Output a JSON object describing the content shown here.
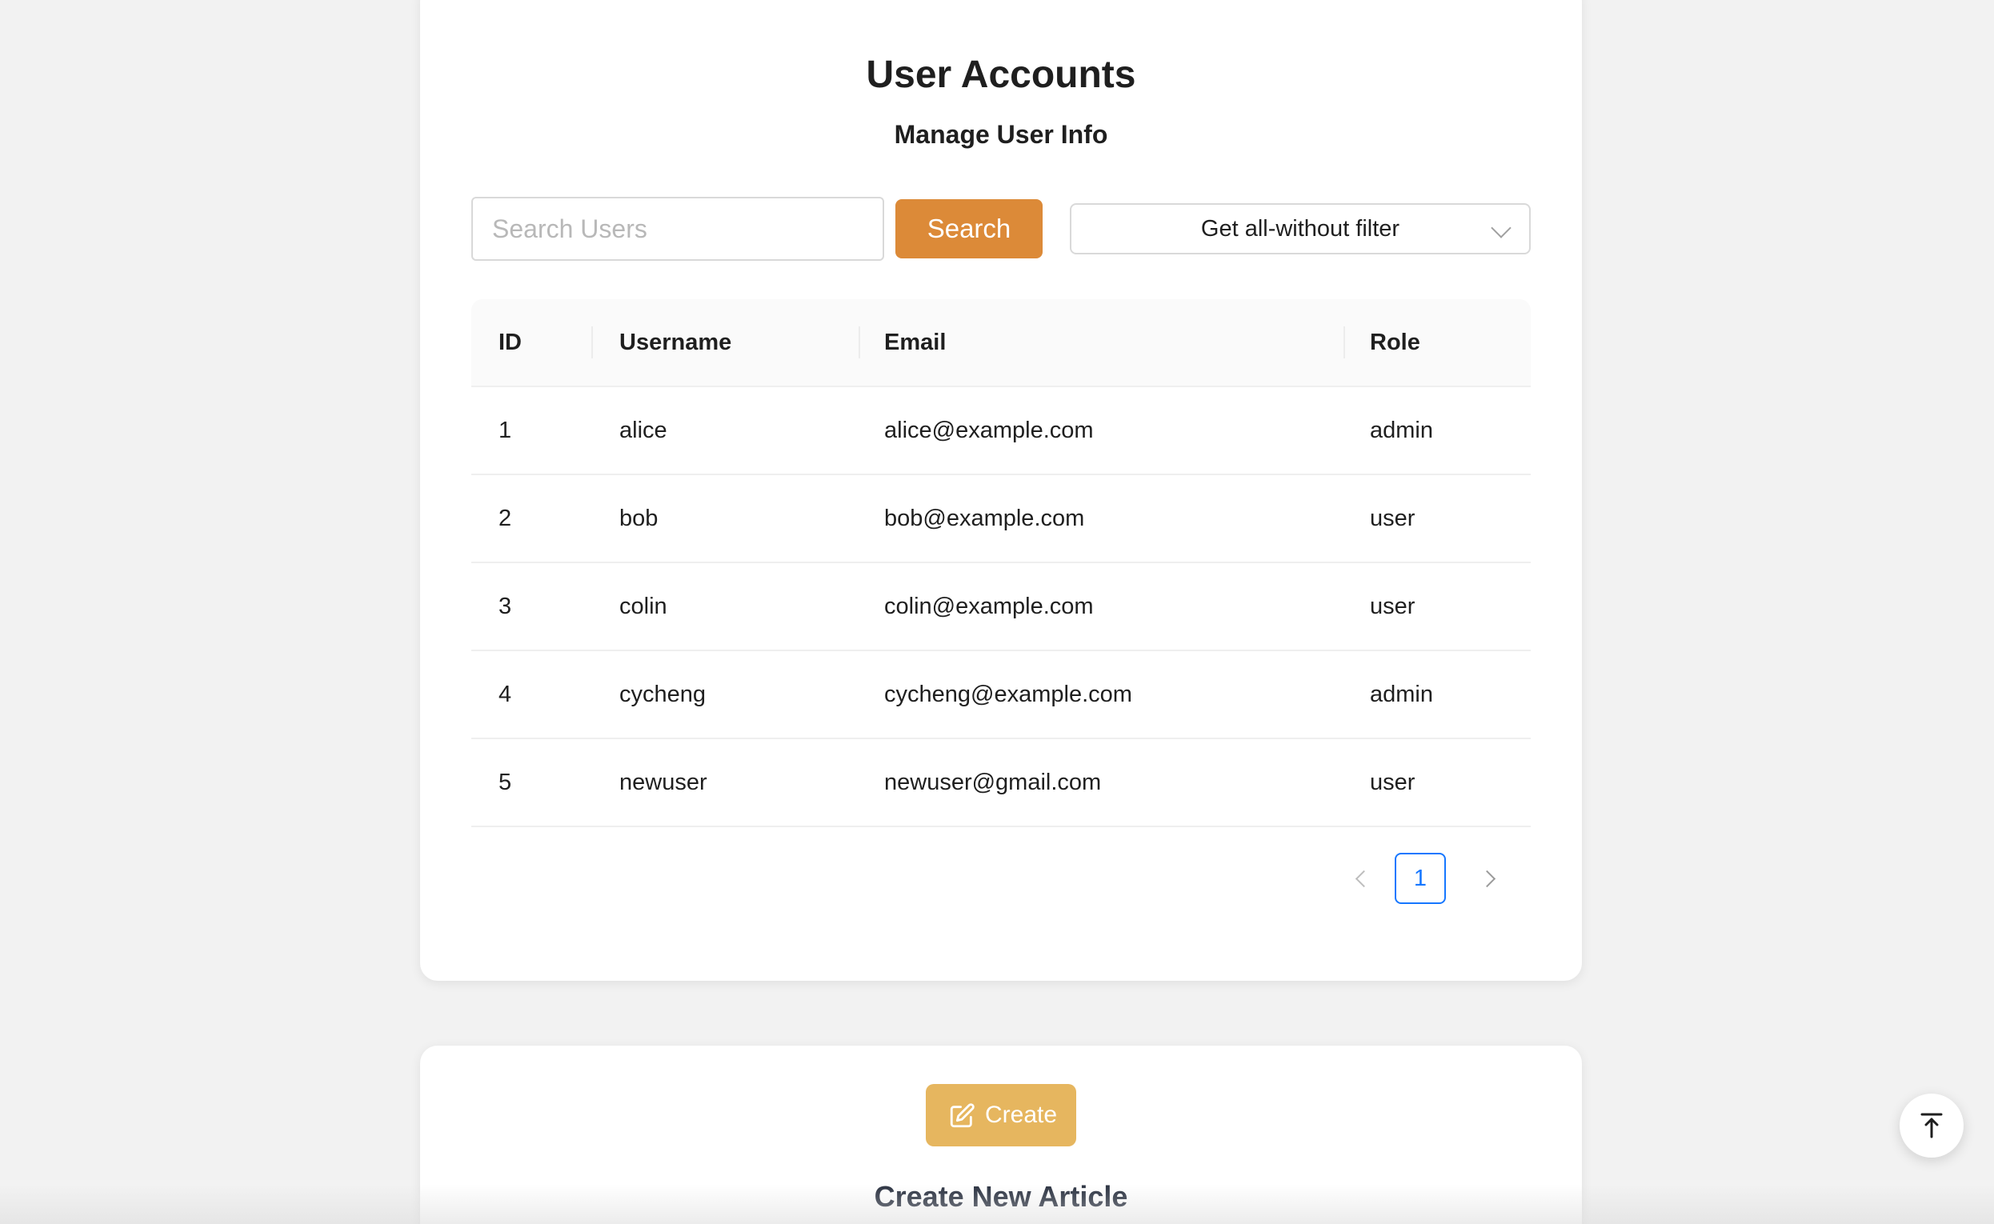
{
  "users_card": {
    "title": "User Accounts",
    "subtitle": "Manage User Info"
  },
  "search": {
    "placeholder": "Search Users",
    "value": "",
    "button_label": "Search"
  },
  "filter": {
    "selected": "Get all-without filter"
  },
  "table": {
    "columns": [
      "ID",
      "Username",
      "Email",
      "Role"
    ],
    "rows": [
      {
        "id": "1",
        "username": "alice",
        "email": "alice@example.com",
        "role": "admin"
      },
      {
        "id": "2",
        "username": "bob",
        "email": "bob@example.com",
        "role": "user"
      },
      {
        "id": "3",
        "username": "colin",
        "email": "colin@example.com",
        "role": "user"
      },
      {
        "id": "4",
        "username": "cycheng",
        "email": "cycheng@example.com",
        "role": "admin"
      },
      {
        "id": "5",
        "username": "newuser",
        "email": "newuser@gmail.com",
        "role": "user"
      }
    ]
  },
  "pagination": {
    "current_page": "1"
  },
  "create_card": {
    "button_label": "Create",
    "button_icon": "edit-icon",
    "title": "Create New Article"
  },
  "back_to_top": {
    "icon": "back-to-top-icon"
  },
  "colors": {
    "page_background": "#f2f2f2",
    "search_button": "#dc8a38",
    "create_button": "#e6b65f",
    "active_page": "#1677ff"
  }
}
